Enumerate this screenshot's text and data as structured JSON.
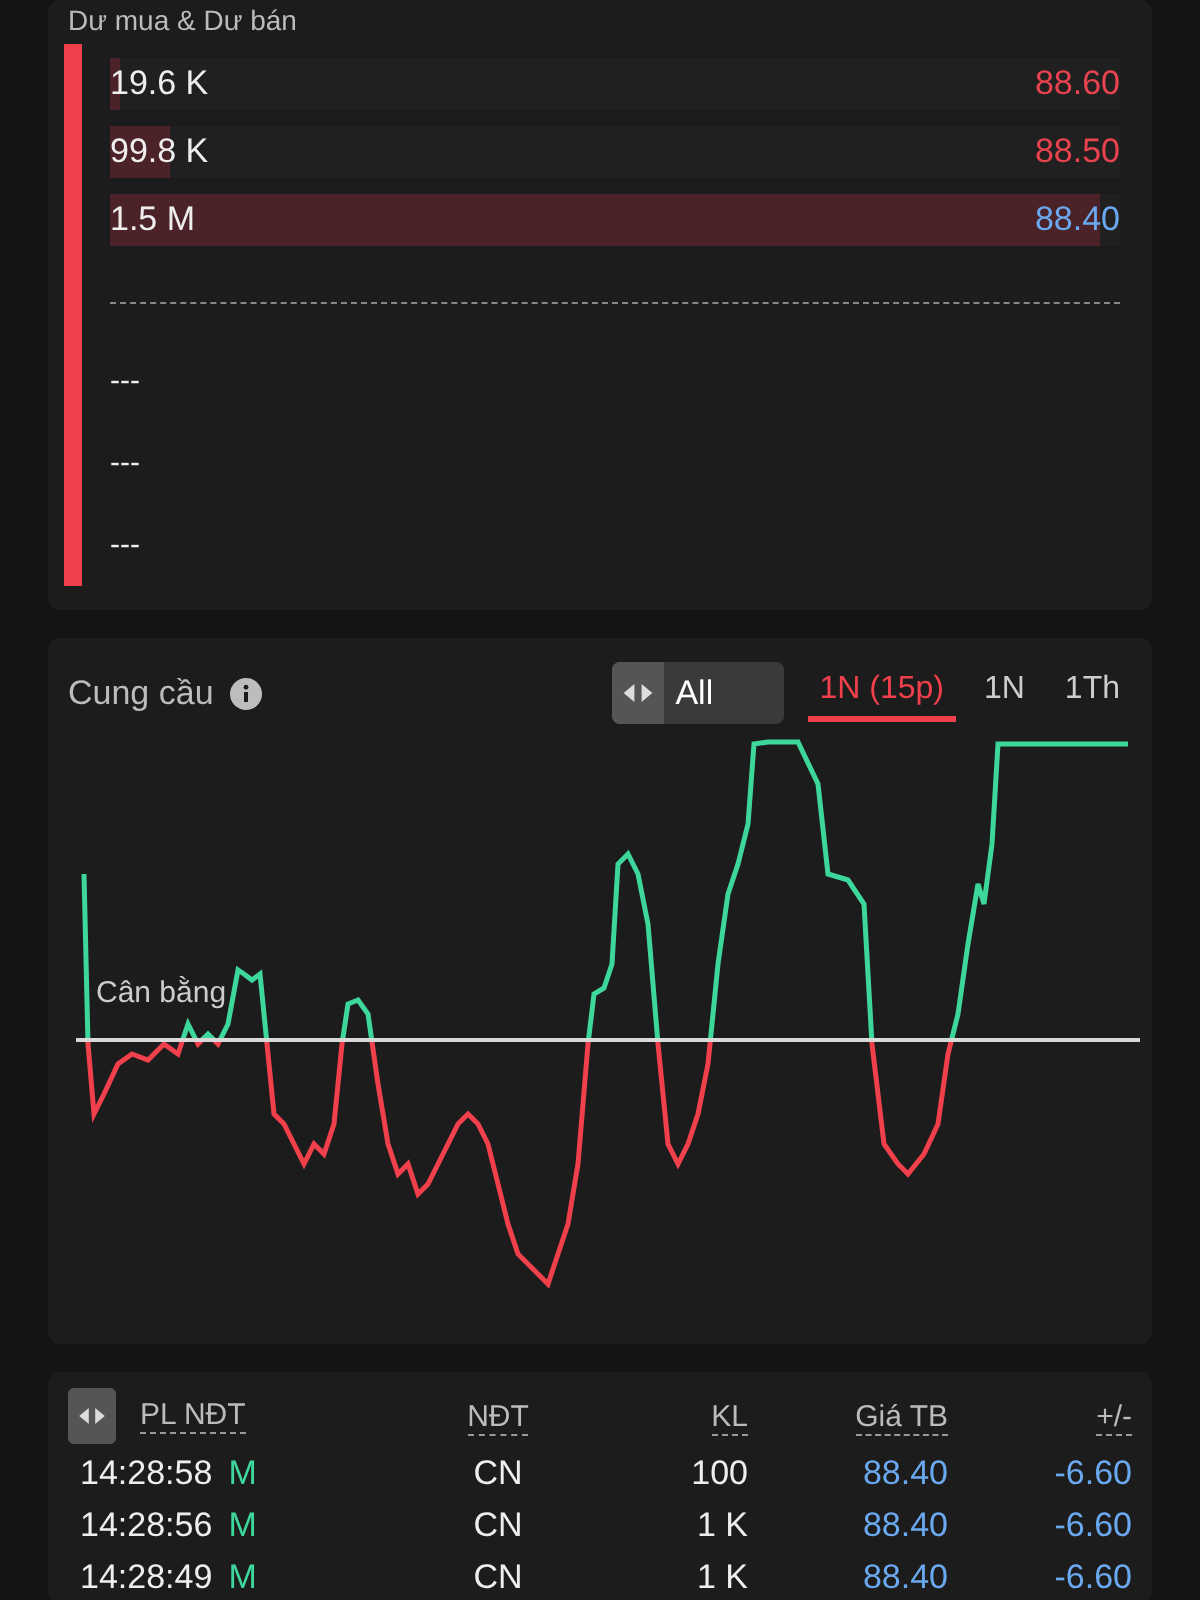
{
  "order_book": {
    "title": "Dư mua & Dư bán",
    "levels": [
      {
        "volume": "19.6 K",
        "price": "88.60",
        "level": 0.01,
        "color": "#e8434f"
      },
      {
        "volume": "99.8 K",
        "price": "88.50",
        "level": 0.06,
        "color": "#e8434f"
      },
      {
        "volume": "1.5 M",
        "price": "88.40",
        "level": 0.98,
        "color": "#6aa9ef"
      }
    ],
    "empty_levels": [
      "---",
      "---",
      "---"
    ]
  },
  "supply_demand": {
    "title": "Cung cầu",
    "filter": {
      "label": "All"
    },
    "tabs": [
      {
        "label": "1N (15p)",
        "selected": true
      },
      {
        "label": "1N",
        "selected": false
      },
      {
        "label": "1Th",
        "selected": false
      }
    ],
    "baseline_label": "Cân bằng"
  },
  "trades": {
    "columns": [
      "PL NĐT",
      "NĐT",
      "KL",
      "Giá TB",
      "+/-"
    ],
    "rows": [
      {
        "time": "14:28:58",
        "side": "M",
        "investor": "CN",
        "volume": "100",
        "price": "88.40",
        "change": "-6.60"
      },
      {
        "time": "14:28:56",
        "side": "M",
        "investor": "CN",
        "volume": "1 K",
        "price": "88.40",
        "change": "-6.60"
      },
      {
        "time": "14:28:49",
        "side": "M",
        "investor": "CN",
        "volume": "1 K",
        "price": "88.40",
        "change": "-6.60"
      }
    ]
  }
}
